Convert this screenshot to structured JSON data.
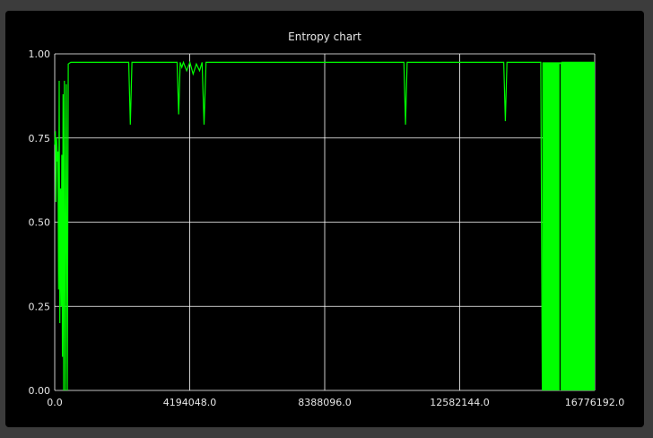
{
  "colors": {
    "background": "#000000",
    "frame": "#3c3c3c",
    "series": "#00ff00",
    "grid": "#ffffff",
    "text": "#e6e6e6"
  },
  "chart_data": {
    "type": "line",
    "title": "Entropy chart",
    "xlabel": "",
    "ylabel": "",
    "xlim": [
      0,
      16776192
    ],
    "ylim": [
      0,
      1
    ],
    "grid": true,
    "x_ticks": [
      0,
      4194048,
      8388096,
      12582144,
      16776192
    ],
    "x_tick_labels": [
      "0.0",
      "4194048.0",
      "8388096.0",
      "12582144.0",
      "16776192.0"
    ],
    "y_ticks": [
      0,
      0.25,
      0.5,
      0.75,
      1
    ],
    "y_tick_labels": [
      "0.00",
      "0.25",
      "0.50",
      "0.75",
      "1.00"
    ],
    "series": [
      {
        "points": [
          [
            0,
            0.73
          ],
          [
            20000,
            0.77
          ],
          [
            40000,
            0.56
          ],
          [
            60000,
            0.75
          ],
          [
            80000,
            0.68
          ],
          [
            100000,
            0.71
          ],
          [
            120000,
            0.3
          ],
          [
            140000,
            0.92
          ],
          [
            160000,
            0.2
          ],
          [
            180000,
            0.6
          ],
          [
            200000,
            0.25
          ],
          [
            220000,
            0.7
          ],
          [
            240000,
            0.1
          ],
          [
            260000,
            0.88
          ],
          [
            280000,
            0.0
          ],
          [
            300000,
            0.92
          ],
          [
            330000,
            0.0
          ],
          [
            360000,
            0.91
          ],
          [
            390000,
            0.0
          ],
          [
            420000,
            0.97
          ],
          [
            500000,
            0.975
          ],
          [
            1000000,
            0.975
          ],
          [
            2300000,
            0.975
          ],
          [
            2350000,
            0.79
          ],
          [
            2400000,
            0.975
          ],
          [
            3800000,
            0.975
          ],
          [
            3850000,
            0.82
          ],
          [
            3900000,
            0.975
          ],
          [
            3950000,
            0.96
          ],
          [
            4000000,
            0.975
          ],
          [
            4100000,
            0.95
          ],
          [
            4200000,
            0.975
          ],
          [
            4300000,
            0.94
          ],
          [
            4400000,
            0.97
          ],
          [
            4500000,
            0.95
          ],
          [
            4580000,
            0.975
          ],
          [
            4640000,
            0.79
          ],
          [
            4700000,
            0.975
          ],
          [
            6000000,
            0.975
          ],
          [
            8000000,
            0.975
          ],
          [
            10850000,
            0.975
          ],
          [
            10900000,
            0.79
          ],
          [
            10950000,
            0.975
          ],
          [
            13950000,
            0.975
          ],
          [
            14000000,
            0.8
          ],
          [
            14050000,
            0.975
          ],
          [
            15100000,
            0.975
          ],
          [
            15150000,
            0.0
          ],
          [
            15660000,
            0.97
          ],
          [
            15700000,
            0.0
          ],
          [
            15760000,
            0.975
          ],
          [
            16776192,
            0.975
          ]
        ],
        "dense_band": {
          "x": [
            15150000,
            16776192
          ],
          "y": [
            0,
            0.975
          ]
        }
      }
    ]
  }
}
